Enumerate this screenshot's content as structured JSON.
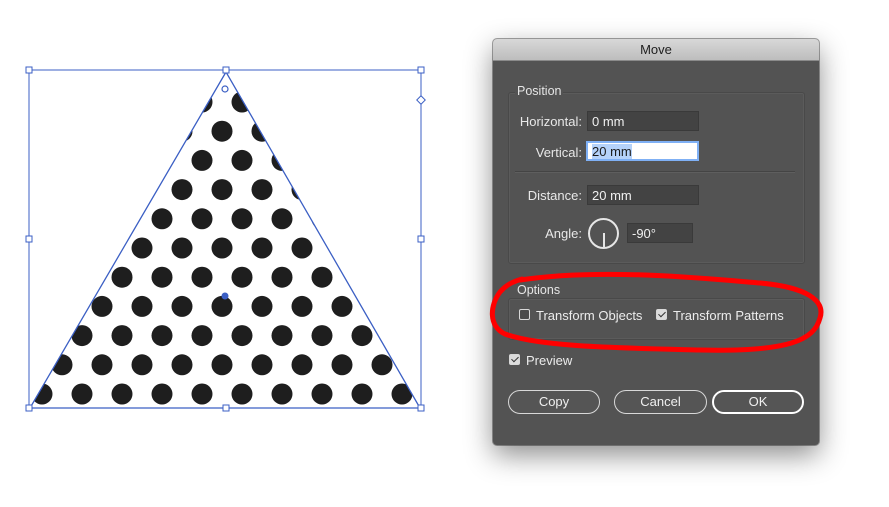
{
  "dialog": {
    "title": "Move",
    "position": {
      "legend": "Position",
      "horizontal_label": "Horizontal:",
      "horizontal_value": "0 mm",
      "vertical_label": "Vertical:",
      "vertical_value": "20 mm",
      "distance_label": "Distance:",
      "distance_value": "20 mm",
      "angle_label": "Angle:",
      "angle_value": "-90°"
    },
    "options": {
      "legend": "Options",
      "transform_objects_label": "Transform Objects",
      "transform_objects_checked": false,
      "transform_patterns_label": "Transform Patterns",
      "transform_patterns_checked": true
    },
    "preview_label": "Preview",
    "preview_checked": true,
    "buttons": {
      "copy": "Copy",
      "cancel": "Cancel",
      "ok": "OK"
    }
  },
  "colors": {
    "selection": "#3b5fc4",
    "dot_fill": "#1e1e1e",
    "annotation": "#ff0000",
    "dialog_bg": "#535353"
  },
  "icons": [
    "angle-dial-icon",
    "checkbox-icon",
    "bounding-box-handle-icon",
    "center-point-icon"
  ]
}
